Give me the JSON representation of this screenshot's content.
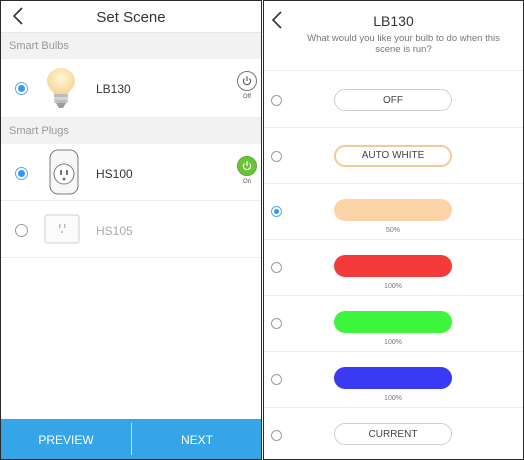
{
  "left": {
    "title": "Set Scene",
    "sections": [
      {
        "label": "Smart Bulbs",
        "devices": [
          {
            "name": "LB130",
            "selected": true,
            "power_state": "Off",
            "icon": "bulb-icon"
          }
        ]
      },
      {
        "label": "Smart Plugs",
        "devices": [
          {
            "name": "HS100",
            "selected": true,
            "power_state": "On",
            "icon": "plug-icon"
          },
          {
            "name": "HS105",
            "selected": false,
            "icon": "mini-plug-icon"
          }
        ]
      }
    ],
    "footer": {
      "preview_label": "PREVIEW",
      "next_label": "NEXT"
    }
  },
  "right": {
    "title": "LB130",
    "subtitle": "What would you like your bulb to do when this scene is run?",
    "options": [
      {
        "label": "OFF",
        "kind": "button",
        "selected": false
      },
      {
        "label": "AUTO WHITE",
        "kind": "button",
        "selected": false
      },
      {
        "label": "",
        "kind": "color",
        "color": "#fdd4a8",
        "brightness": "50%",
        "selected": true
      },
      {
        "label": "",
        "kind": "color",
        "color": "#f53a3a",
        "brightness": "100%",
        "selected": false
      },
      {
        "label": "",
        "kind": "color",
        "color": "#3cf53c",
        "brightness": "100%",
        "selected": false
      },
      {
        "label": "",
        "kind": "color",
        "color": "#3a3af5",
        "brightness": "100%",
        "selected": false
      },
      {
        "label": "CURRENT",
        "kind": "button",
        "selected": false
      }
    ]
  },
  "colors": {
    "accent": "#36a5e8",
    "radio_selected": "#3399ee",
    "power_on": "#6cc33a"
  }
}
